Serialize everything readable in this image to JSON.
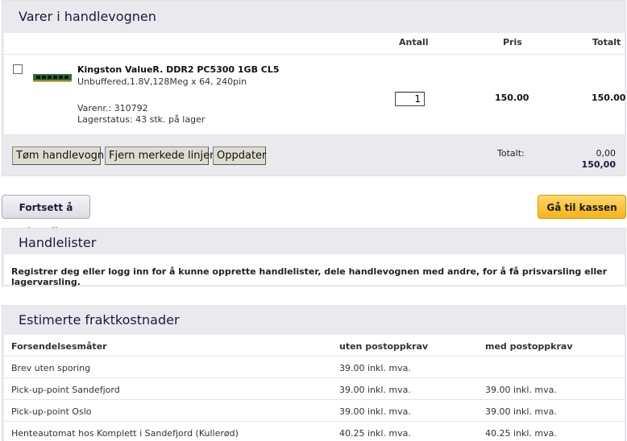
{
  "cart": {
    "title": "Varer i handlevognen",
    "headers": {
      "qty": "Antall",
      "price": "Pris",
      "total": "Totalt"
    },
    "item": {
      "name": "Kingston ValueR. DDR2 PC5300 1GB CL5",
      "description": "Unbuffered,1.8V,128Meg x 64, 240pin",
      "sku": "Varenr.: 310792",
      "stock": "Lagerstatus: 43 stk. på lager",
      "quantity": "1",
      "price": "150.00",
      "total": "150.00"
    },
    "buttons": {
      "empty": "Tøm handlevogn",
      "remove_marked": "Fjern merkede linjer",
      "update": "Oppdater"
    },
    "totals": {
      "label": "Totalt:",
      "value1": "0,00",
      "value2": "150,00"
    }
  },
  "actions": {
    "continue": "Fortsett å handle",
    "checkout": "Gå til kassen"
  },
  "lists": {
    "title": "Handlelister",
    "message": "Registrer deg eller logg inn for å kunne opprette handlelister, dele handlevognen med andre, for å få prisvarsling eller lagervarsling."
  },
  "shipping": {
    "title": "Estimerte fraktkostnader",
    "headers": [
      "Forsendelsesmåter",
      "uten postoppkrav",
      "med postoppkrav"
    ],
    "rows": [
      {
        "method": "Brev uten sporing",
        "without_cod": "39.00 inkl. mva.",
        "with_cod": ""
      },
      {
        "method": "Pick-up-point Sandefjord",
        "without_cod": "39.00 inkl. mva.",
        "with_cod": "39.00 inkl. mva."
      },
      {
        "method": "Pick-up-point Oslo",
        "without_cod": "39.00 inkl. mva.",
        "with_cod": "39.00 inkl. mva."
      },
      {
        "method": "Henteautomat hos Komplett i Sandefjord (Kullerød)",
        "without_cod": "40.25 inkl. mva.",
        "with_cod": "40.25 inkl. mva."
      }
    ]
  }
}
